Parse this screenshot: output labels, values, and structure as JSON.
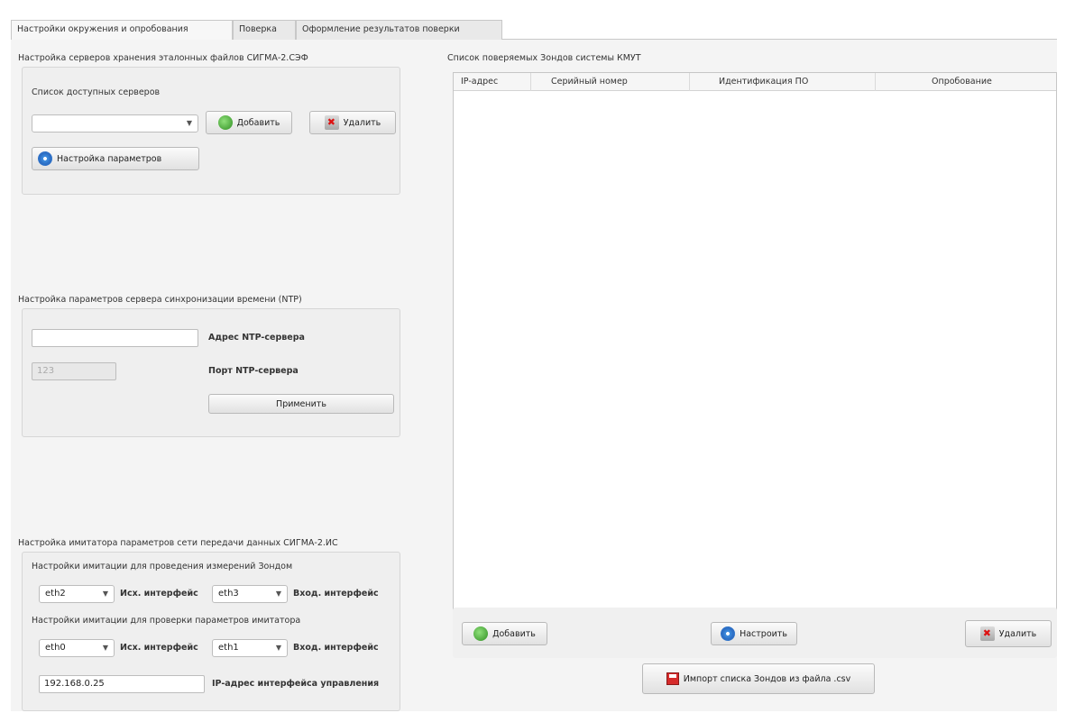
{
  "tabs": [
    {
      "label": "Настройки окружения и опробования"
    },
    {
      "label": "Поверка"
    },
    {
      "label": "Оформление результатов поверки"
    }
  ],
  "storage": {
    "title": "Настройка серверов хранения эталонных файлов СИГМА-2.СЭФ",
    "servers_label": "Список доступных серверов",
    "servers_value": "",
    "add_label": "Добавить",
    "delete_label": "Удалить",
    "params_label": "Настройка параметров"
  },
  "ntp": {
    "title": "Настройка параметров сервера синхронизации времени (NTP)",
    "address_value": "",
    "address_label": "Адрес NTP-сервера",
    "port_value": "123",
    "port_label": "Порт NTP-сервера",
    "apply_label": "Применить"
  },
  "simulator": {
    "title": "Настройка имитатора параметров сети передачи данных СИГМА-2.ИС",
    "section1_label": "Настройки имитации для проведения измерений Зондом",
    "section1_out_value": "eth2",
    "section1_in_value": "eth3",
    "section2_label": "Настройки имитации для проверки параметров имитатора",
    "section2_out_value": "eth0",
    "section2_in_value": "eth1",
    "out_iface_label": "Исх. интерфейс",
    "in_iface_label": "Вход. интерфейс",
    "mgmt_ip_value": "192.168.0.25",
    "mgmt_ip_label": "IP-адрес интерфейса управления"
  },
  "probes": {
    "title": "Список поверяемых Зондов системы КМУТ",
    "columns": [
      "IP-адрес",
      "Серийный номер",
      "Идентификация ПО",
      "Опробование"
    ],
    "add_label": "Добавить",
    "configure_label": "Настроить",
    "delete_label": "Удалить",
    "import_label": "Импорт списка Зондов из файла .csv"
  }
}
